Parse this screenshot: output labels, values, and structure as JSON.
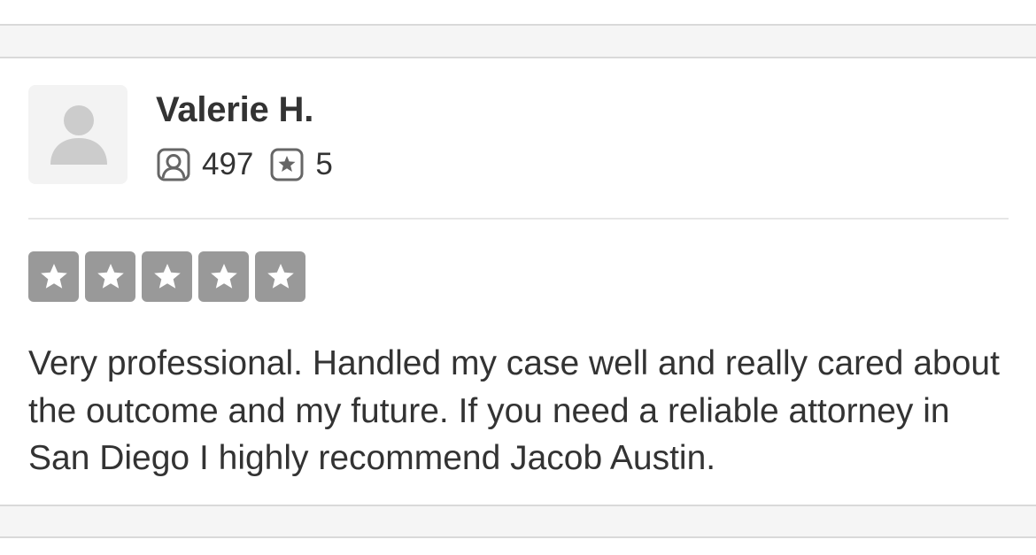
{
  "review": {
    "user": {
      "name": "Valerie H.",
      "avatar_icon": "default-user-silhouette-icon"
    },
    "stats": {
      "friends_icon": "friends-icon",
      "friends_count": "497",
      "reviews_icon": "reviews-star-icon",
      "reviews_count": "5"
    },
    "rating": {
      "stars": 5,
      "max_stars": 5,
      "star_color": "#999999"
    },
    "text": "Very professional. Handled my case well and really cared about the outcome and my future. If you need a reliable attorney in San Diego I highly recommend Jacob Austin."
  },
  "colors": {
    "text": "#333333",
    "separator_band": "#f5f5f5",
    "band_border": "#d9d9d9",
    "avatar_bg": "#f3f3f3",
    "avatar_silhouette": "#cccccc",
    "icon_stroke": "#666666"
  }
}
